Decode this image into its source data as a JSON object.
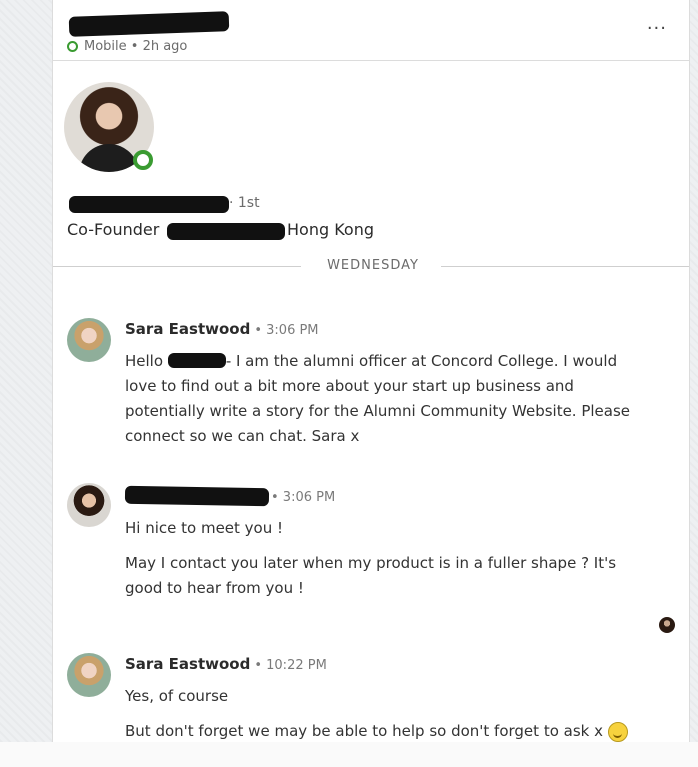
{
  "header": {
    "status_text": "Mobile • 2h ago",
    "more_label": "···"
  },
  "profile": {
    "connection_degree": "· 1st",
    "headline_prefix": "Co-Founder",
    "headline_suffix": "Hong Kong"
  },
  "divider": {
    "label": "WEDNESDAY"
  },
  "messages": [
    {
      "sender": "Sara Eastwood",
      "time": "• 3:06 PM",
      "lines": [
        "Hello",
        "- I am the alumni officer at Concord College. I would",
        "love to find out a bit more about your start up business and",
        "potentially write a story for the Alumni Community Website. Please",
        "connect so we can chat. Sara x"
      ]
    },
    {
      "sender": "",
      "time": "• 3:06 PM",
      "lines": [
        "Hi nice to meet you !",
        "May I contact you later when my product is in a fuller shape ? It's",
        "good to hear from you !"
      ]
    },
    {
      "sender": "Sara Eastwood",
      "time": "• 10:22 PM",
      "lines": [
        "Yes, of course",
        "But don't forget we may be able to help so don't forget to ask x"
      ]
    }
  ],
  "colors": {
    "online_green": "#3a9b31",
    "redaction": "#111111"
  }
}
